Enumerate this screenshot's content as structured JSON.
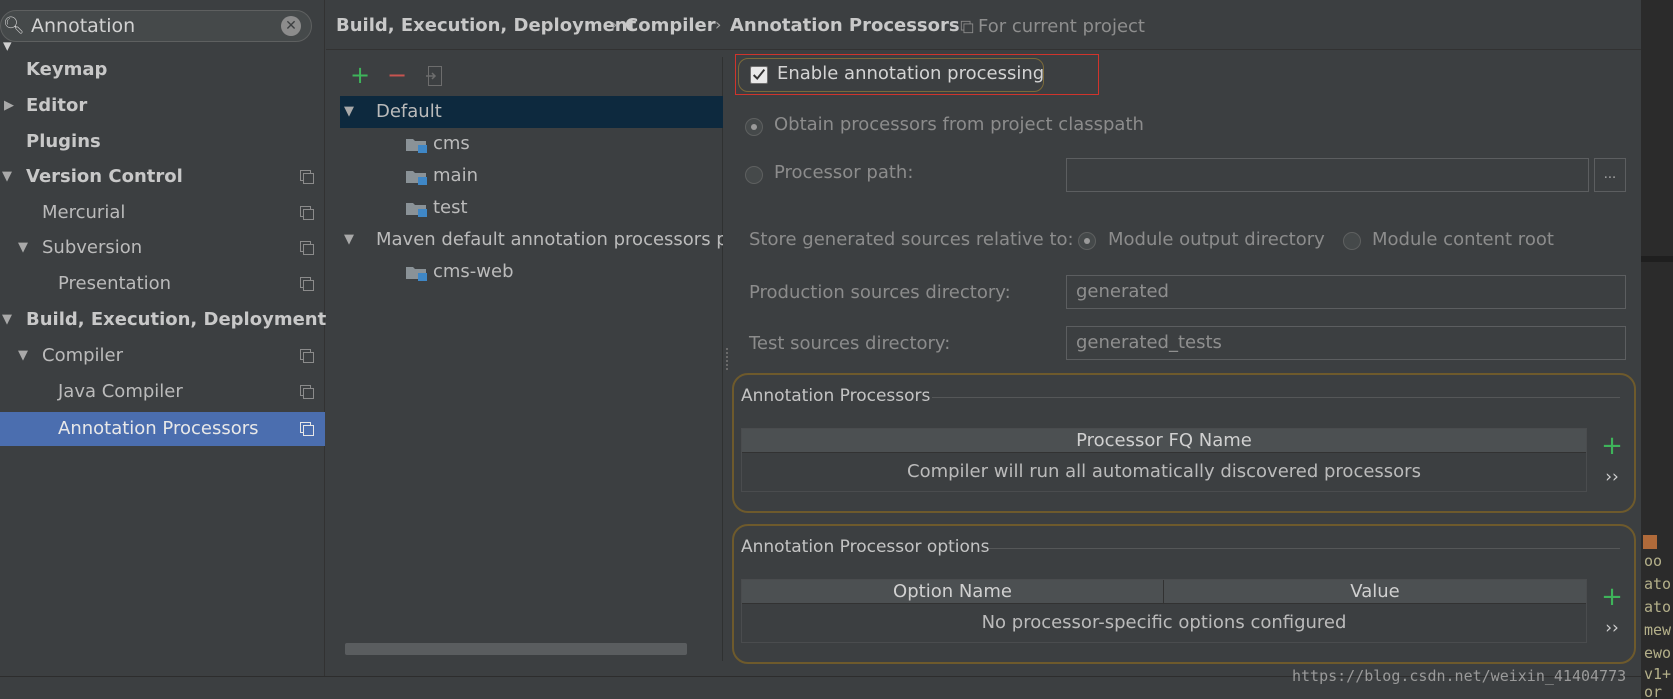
{
  "search": {
    "value": "Annotation",
    "icon": "search-icon",
    "clear_icon": "clear-icon"
  },
  "sidebar": {
    "items": [
      {
        "label": "Keymap"
      },
      {
        "label": "Editor"
      },
      {
        "label": "Plugins"
      },
      {
        "label": "Version Control"
      },
      {
        "label": "Mercurial"
      },
      {
        "label": "Subversion"
      },
      {
        "label": "Presentation"
      },
      {
        "label": "Build, Execution, Deployment"
      },
      {
        "label": "Compiler"
      },
      {
        "label": "Java Compiler"
      },
      {
        "label": "Annotation Processors"
      }
    ],
    "selected": "Annotation Processors",
    "selected_color": "#4b6eaf"
  },
  "breadcrumb": {
    "items": [
      "Build, Execution, Deployment",
      "Compiler",
      "Annotation Processors"
    ],
    "separator": "›",
    "scope": "For current project"
  },
  "profiles": {
    "toolbar": {
      "add": "+",
      "remove": "−"
    },
    "tree": [
      {
        "label": "Default"
      },
      {
        "label": "cms"
      },
      {
        "label": "main"
      },
      {
        "label": "test"
      },
      {
        "label": "Maven default annotation processors pro"
      },
      {
        "label": "cms-web"
      }
    ]
  },
  "settings": {
    "enable_label": "Enable annotation processing",
    "enable_checked": true,
    "obtain_label": "Obtain processors from project classpath",
    "processor_path_label": "Processor path:",
    "processor_path_value": "",
    "browse_label": "...",
    "store_label": "Store generated sources relative to:",
    "module_output_label": "Module output directory",
    "module_content_label": "Module content root",
    "production_label": "Production sources directory:",
    "production_value": "generated",
    "test_label": "Test sources directory:",
    "test_value": "generated_tests"
  },
  "processors_group": {
    "title": "Annotation Processors",
    "column": "Processor FQ Name",
    "empty_text": "Compiler will run all automatically discovered processors",
    "add": "+",
    "more": "››"
  },
  "options_group": {
    "title": "Annotation Processor options",
    "columns": [
      "Option Name",
      "Value"
    ],
    "empty_text": "No processor-specific options configured",
    "add": "+",
    "more": "››"
  },
  "editor_edge": {
    "lines": [
      "oo",
      "ato",
      "ato",
      "mew",
      "ewo",
      "v1+",
      "or"
    ]
  },
  "watermark": "https://blog.csdn.net/weixin_41404773",
  "colors": {
    "accent_green": "#3eb45a",
    "remove_red": "#c75450",
    "highlight_box": "#d0342c",
    "group_border": "#6e5a2c"
  }
}
